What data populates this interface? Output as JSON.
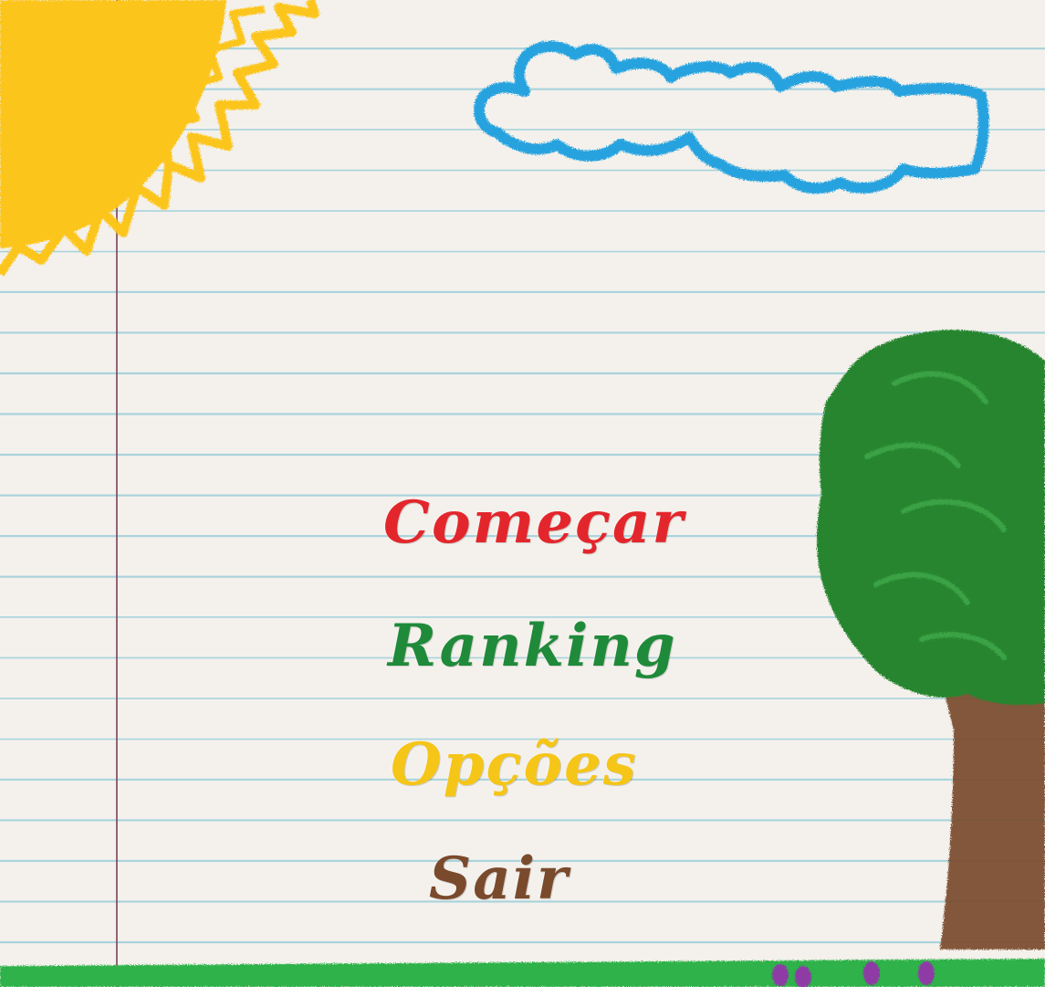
{
  "menu": {
    "items": [
      {
        "label": "Começar",
        "color": "#e3262c"
      },
      {
        "label": "Ranking",
        "color": "#1f8a3a"
      },
      {
        "label": "Opções",
        "color": "#f5c518"
      },
      {
        "label": "Sair",
        "color": "#7a4a2c"
      }
    ]
  },
  "scene": {
    "sun_color": "#fcc51a",
    "cloud_color": "#27a3df",
    "tree_leaves_color": "#27852f",
    "trunk_color": "#7a4a2c",
    "grass_color": "#2fb24a",
    "flower_color": "#8e3aa6"
  }
}
